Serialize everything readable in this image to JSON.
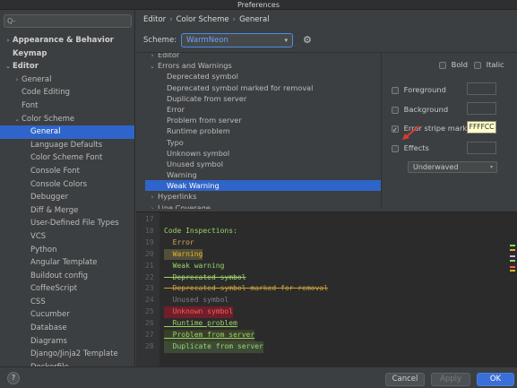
{
  "window": {
    "title": "Preferences"
  },
  "search": {
    "placeholder": "Q-"
  },
  "sidebar": {
    "items": [
      {
        "label": "Appearance & Behavior",
        "arrow": "›",
        "bold": true,
        "indent": 0
      },
      {
        "label": "Keymap",
        "arrow": "",
        "bold": true,
        "indent": 0
      },
      {
        "label": "Editor",
        "arrow": "⌄",
        "bold": true,
        "indent": 0
      },
      {
        "label": "General",
        "arrow": "›",
        "bold": false,
        "indent": 1
      },
      {
        "label": "Code Editing",
        "arrow": "",
        "bold": false,
        "indent": 1
      },
      {
        "label": "Font",
        "arrow": "",
        "bold": false,
        "indent": 1
      },
      {
        "label": "Color Scheme",
        "arrow": "⌄",
        "bold": false,
        "indent": 1
      },
      {
        "label": "General",
        "arrow": "",
        "bold": false,
        "indent": 2,
        "selected": true
      },
      {
        "label": "Language Defaults",
        "arrow": "",
        "bold": false,
        "indent": 2
      },
      {
        "label": "Color Scheme Font",
        "arrow": "",
        "bold": false,
        "indent": 2
      },
      {
        "label": "Console Font",
        "arrow": "",
        "bold": false,
        "indent": 2
      },
      {
        "label": "Console Colors",
        "arrow": "",
        "bold": false,
        "indent": 2
      },
      {
        "label": "Debugger",
        "arrow": "",
        "bold": false,
        "indent": 2
      },
      {
        "label": "Diff & Merge",
        "arrow": "",
        "bold": false,
        "indent": 2
      },
      {
        "label": "User-Defined File Types",
        "arrow": "",
        "bold": false,
        "indent": 2
      },
      {
        "label": "VCS",
        "arrow": "",
        "bold": false,
        "indent": 2
      },
      {
        "label": "Python",
        "arrow": "",
        "bold": false,
        "indent": 2
      },
      {
        "label": "Angular Template",
        "arrow": "",
        "bold": false,
        "indent": 2
      },
      {
        "label": "Buildout config",
        "arrow": "",
        "bold": false,
        "indent": 2
      },
      {
        "label": "CoffeeScript",
        "arrow": "",
        "bold": false,
        "indent": 2
      },
      {
        "label": "CSS",
        "arrow": "",
        "bold": false,
        "indent": 2
      },
      {
        "label": "Cucumber",
        "arrow": "",
        "bold": false,
        "indent": 2
      },
      {
        "label": "Database",
        "arrow": "",
        "bold": false,
        "indent": 2
      },
      {
        "label": "Diagrams",
        "arrow": "",
        "bold": false,
        "indent": 2
      },
      {
        "label": "Django/Jinja2 Template",
        "arrow": "",
        "bold": false,
        "indent": 2
      },
      {
        "label": "Dockerfile",
        "arrow": "",
        "bold": false,
        "indent": 2
      }
    ]
  },
  "breadcrumb": {
    "parts": [
      "Editor",
      "Color Scheme",
      "General"
    ],
    "sep": "›"
  },
  "scheme": {
    "label": "Scheme:",
    "value": "WarmNeon",
    "caret": "▾",
    "gear": "⚙"
  },
  "inspections": {
    "items": [
      {
        "label": "Editor",
        "arrow": "›",
        "indent": 0
      },
      {
        "label": "Errors and Warnings",
        "arrow": "⌄",
        "indent": 0
      },
      {
        "label": "Deprecated symbol",
        "arrow": "",
        "indent": 1
      },
      {
        "label": "Deprecated symbol marked for removal",
        "arrow": "",
        "indent": 1
      },
      {
        "label": "Duplicate from server",
        "arrow": "",
        "indent": 1
      },
      {
        "label": "Error",
        "arrow": "",
        "indent": 1
      },
      {
        "label": "Problem from server",
        "arrow": "",
        "indent": 1
      },
      {
        "label": "Runtime problem",
        "arrow": "",
        "indent": 1
      },
      {
        "label": "Typo",
        "arrow": "",
        "indent": 1
      },
      {
        "label": "Unknown symbol",
        "arrow": "",
        "indent": 1
      },
      {
        "label": "Unused symbol",
        "arrow": "",
        "indent": 1
      },
      {
        "label": "Warning",
        "arrow": "",
        "indent": 1
      },
      {
        "label": "Weak Warning",
        "arrow": "",
        "indent": 1,
        "selected": true
      },
      {
        "label": "Hyperlinks",
        "arrow": "›",
        "indent": 0
      },
      {
        "label": "Line Coverage",
        "arrow": "›",
        "indent": 0
      }
    ]
  },
  "attributes": {
    "bold_label": "Bold",
    "italic_label": "Italic",
    "foreground_label": "Foreground",
    "background_label": "Background",
    "error_stripe_label": "Error stripe mark",
    "error_stripe_value": "FFFFCC",
    "effects_label": "Effects",
    "effects_type": "Underwaved",
    "dropdown_caret": "▾",
    "checked": {
      "bold": false,
      "italic": false,
      "foreground": false,
      "background": false,
      "error_stripe": true,
      "effects": false
    }
  },
  "preview": {
    "lines": [
      {
        "n": "17",
        "text": "",
        "color": "#a9b7c6"
      },
      {
        "n": "18",
        "text": "Code Inspections:",
        "color": "#9ad46a"
      },
      {
        "n": "19",
        "text": "  Error",
        "color": "#d9a45a"
      },
      {
        "n": "20",
        "text": "  Warning",
        "color": "#e6b422",
        "bg": "#52503a"
      },
      {
        "n": "21",
        "text": "  Weak warning",
        "color": "#9ad46a"
      },
      {
        "n": "22",
        "text": "  Deprecated symbol",
        "color": "#9ad46a",
        "strike": true
      },
      {
        "n": "23",
        "text": "  Deprecated symbol marked for removal",
        "color": "#c9a23a",
        "strike": true
      },
      {
        "n": "24",
        "text": "  Unused symbol",
        "color": "#7a7e80"
      },
      {
        "n": "25",
        "text": "  Unknown symbol",
        "color": "#ff5a5a",
        "bg": "#6e1f2a"
      },
      {
        "n": "26",
        "text": "  Runtime problem",
        "color": "#9ad46a",
        "underline": true
      },
      {
        "n": "27",
        "text": "  Problem from server",
        "color": "#9ad46a",
        "bg": "#3a3f2a",
        "underline": true
      },
      {
        "n": "28",
        "text": "  Duplicate from server",
        "color": "#9ad46a",
        "bg": "#3d4a37"
      }
    ],
    "marks": [
      "#7ad97a",
      "#e6b422",
      "#c9a9ff",
      "#9ad46a",
      "#ff5a5a",
      "#e6b422"
    ]
  },
  "footer": {
    "help": "?",
    "cancel": "Cancel",
    "apply": "Apply",
    "ok": "OK"
  }
}
